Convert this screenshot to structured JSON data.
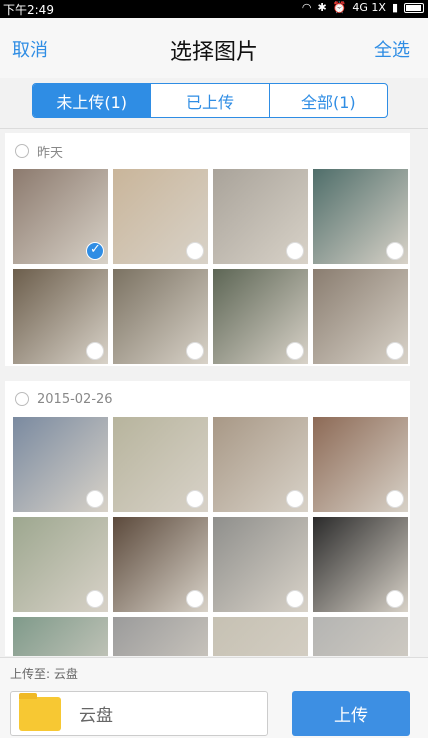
{
  "status_bar": {
    "time": "下午2:49",
    "net": "4G 1X"
  },
  "header": {
    "cancel": "取消",
    "title": "选择图片",
    "select_all": "全选"
  },
  "tabs": [
    {
      "label": "未上传(1)",
      "active": true
    },
    {
      "label": "已上传",
      "active": false
    },
    {
      "label": "全部(1)",
      "active": false
    }
  ],
  "sections": [
    {
      "date": "昨天",
      "photos": [
        {
          "color": "#8c7a6e",
          "selected": true
        },
        {
          "color": "#c9b59a",
          "selected": false
        },
        {
          "color": "#a9a39a",
          "selected": false
        },
        {
          "color": "#4f6e6a",
          "selected": false
        },
        {
          "color": "#6c5e4c",
          "selected": false
        },
        {
          "color": "#7b7262",
          "selected": false
        },
        {
          "color": "#5d6655",
          "selected": false
        },
        {
          "color": "#8a7d70",
          "selected": false
        }
      ]
    },
    {
      "date": "2015-02-26",
      "photos": [
        {
          "color": "#7a8aa0",
          "selected": false
        },
        {
          "color": "#b7b49d",
          "selected": false
        },
        {
          "color": "#a89886",
          "selected": false
        },
        {
          "color": "#8d6a56",
          "selected": false
        },
        {
          "color": "#9da78f",
          "selected": false
        },
        {
          "color": "#5c4a3c",
          "selected": false
        },
        {
          "color": "#8f8f8c",
          "selected": false
        },
        {
          "color": "#2b2b2b",
          "selected": false
        },
        {
          "color": "#7f9a8a",
          "selected": false
        },
        {
          "color": "#9b9b9b",
          "selected": false
        },
        {
          "color": "#c6c1b3",
          "selected": false
        },
        {
          "color": "#b4b4b2",
          "selected": false
        }
      ]
    }
  ],
  "footer": {
    "upload_to": "上传至: 云盘",
    "destination": "云盘",
    "upload_button": "上传"
  },
  "colors": {
    "accent": "#2f8de4"
  }
}
